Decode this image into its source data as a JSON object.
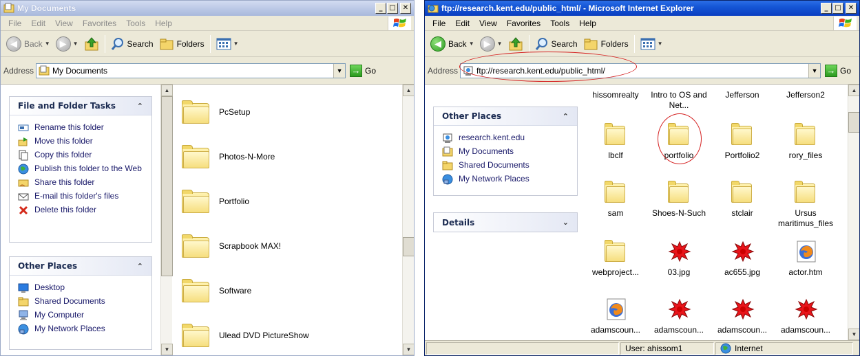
{
  "left_window": {
    "title": "My Documents",
    "menu": [
      "File",
      "Edit",
      "View",
      "Favorites",
      "Tools",
      "Help"
    ],
    "toolbar": {
      "back": "Back",
      "search": "Search",
      "folders": "Folders"
    },
    "address_label": "Address",
    "address_value": "My Documents",
    "go": "Go",
    "file_tasks": {
      "title": "File and Folder Tasks",
      "items": [
        {
          "label": "Rename this folder",
          "icon": "rename-icon"
        },
        {
          "label": "Move this folder",
          "icon": "move-icon"
        },
        {
          "label": "Copy this folder",
          "icon": "copy-icon"
        },
        {
          "label": "Publish this folder to the Web",
          "icon": "publish-web-icon"
        },
        {
          "label": "Share this folder",
          "icon": "share-icon"
        },
        {
          "label": "E-mail this folder's files",
          "icon": "email-icon"
        },
        {
          "label": "Delete this folder",
          "icon": "delete-icon"
        }
      ]
    },
    "other_places": {
      "title": "Other Places",
      "items": [
        {
          "label": "Desktop",
          "icon": "desktop-icon"
        },
        {
          "label": "Shared Documents",
          "icon": "folder-icon"
        },
        {
          "label": "My Computer",
          "icon": "computer-icon"
        },
        {
          "label": "My Network Places",
          "icon": "network-icon"
        }
      ]
    },
    "folders": [
      "PcSetup",
      "Photos-N-More",
      "Portfolio",
      "Scrapbook MAX!",
      "Software",
      "Ulead DVD PictureShow"
    ]
  },
  "right_window": {
    "title": "ftp://research.kent.edu/public_html/ - Microsoft Internet Explorer",
    "menu": [
      "File",
      "Edit",
      "View",
      "Favorites",
      "Tools",
      "Help"
    ],
    "toolbar": {
      "back": "Back",
      "search": "Search",
      "folders": "Folders"
    },
    "address_label": "Address",
    "address_value": "ftp://research.kent.edu/public_html/",
    "go": "Go",
    "other_places": {
      "title": "Other Places",
      "items": [
        {
          "label": "research.kent.edu",
          "icon": "ftp-site-icon"
        },
        {
          "label": "My Documents",
          "icon": "my-documents-icon"
        },
        {
          "label": "Shared Documents",
          "icon": "folder-icon"
        },
        {
          "label": "My Network Places",
          "icon": "network-icon"
        }
      ]
    },
    "details_title": "Details",
    "top_row_labels": [
      "hissomrealty",
      "Intro to OS and Net...",
      "Jefferson",
      "Jefferson2"
    ],
    "row2": [
      "lbclf",
      "portfolio",
      "Portfolio2",
      "rory_files"
    ],
    "row3": [
      "sam",
      "Shoes-N-Such",
      "stclair",
      "Ursus maritimus_files"
    ],
    "row4": [
      "webproject...",
      "03.jpg",
      "ac655.jpg",
      "actor.htm"
    ],
    "row5": [
      "adamscoun...",
      "adamscoun...",
      "adamscoun...",
      "adamscoun..."
    ],
    "status": {
      "user": "User: ahissom1",
      "zone": "Internet"
    }
  }
}
